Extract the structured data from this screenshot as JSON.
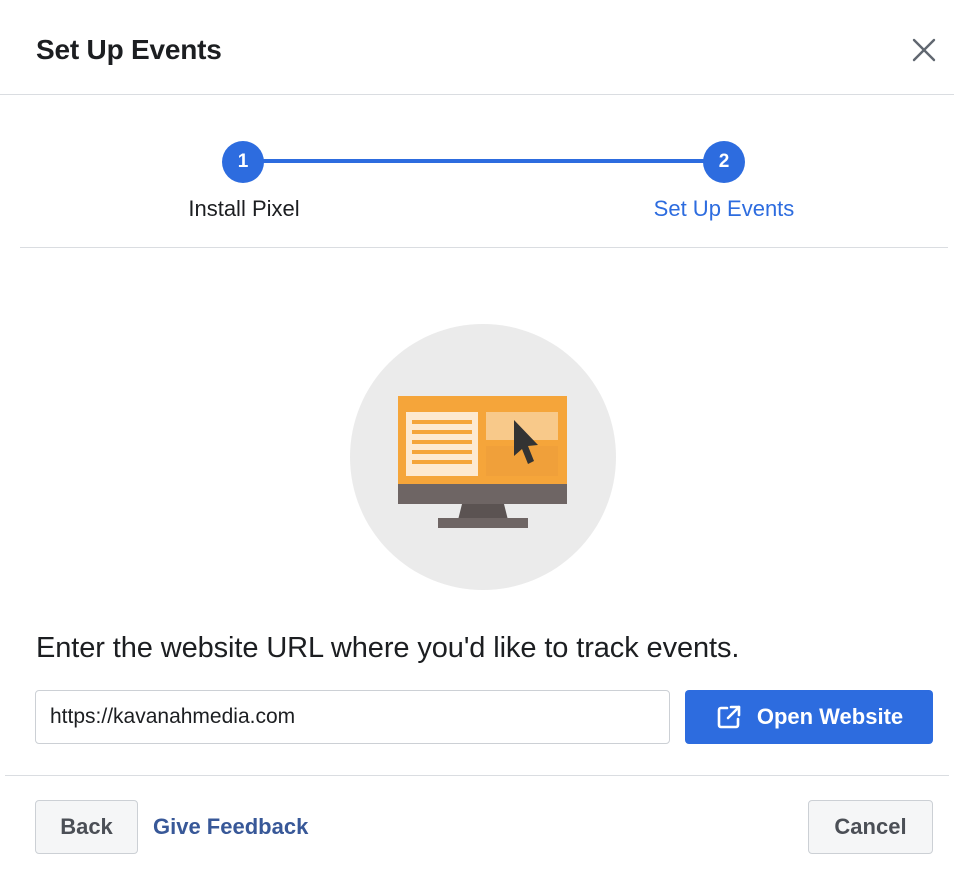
{
  "dialog": {
    "title": "Set Up Events",
    "close_icon": "close-icon"
  },
  "stepper": {
    "steps": [
      {
        "number": "1",
        "label": "Install Pixel",
        "state": "completed"
      },
      {
        "number": "2",
        "label": "Set Up Events",
        "state": "active"
      }
    ],
    "accent_color": "#2d6cdf"
  },
  "illustration": {
    "icon": "monitor-website-icon",
    "colors": {
      "circle": "#ebebeb",
      "screen": "#f5a53a",
      "stand": "#6e6564"
    }
  },
  "main": {
    "prompt": "Enter the website URL where you'd like to track events.",
    "url_value": "https://kavanahmedia.com",
    "open_button_label": "Open Website",
    "open_button_icon": "external-link-icon"
  },
  "footer": {
    "back_label": "Back",
    "feedback_label": "Give Feedback",
    "cancel_label": "Cancel"
  },
  "colors": {
    "primary": "#2d6cdf",
    "link": "#385898",
    "divider": "#dadde1"
  }
}
